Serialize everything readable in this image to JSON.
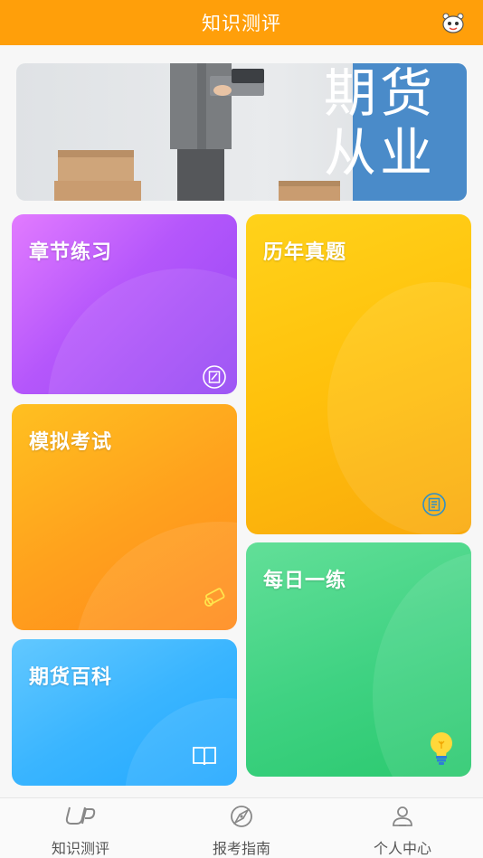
{
  "header": {
    "title": "知识测评",
    "robot_icon": "robot-icon"
  },
  "banner": {
    "calligraphy": "期货\n从业"
  },
  "cards": [
    {
      "id": "chapter",
      "label": "章节练习",
      "icon": "edit-note-icon"
    },
    {
      "id": "history",
      "label": "历年真题",
      "icon": "document-icon"
    },
    {
      "id": "mock",
      "label": "模拟考试",
      "icon": "diploma-scroll-icon"
    },
    {
      "id": "daily",
      "label": "每日一练",
      "icon": "lightbulb-icon"
    },
    {
      "id": "wiki",
      "label": "期货百科",
      "icon": "open-book-icon"
    }
  ],
  "tabbar": [
    {
      "label": "知识测评",
      "icon": "up-logo-icon"
    },
    {
      "label": "报考指南",
      "icon": "compass-icon"
    },
    {
      "label": "个人中心",
      "icon": "person-icon"
    }
  ],
  "colors": {
    "accent": "#ff9f0a",
    "banner_blue": "#4a8bc9"
  }
}
